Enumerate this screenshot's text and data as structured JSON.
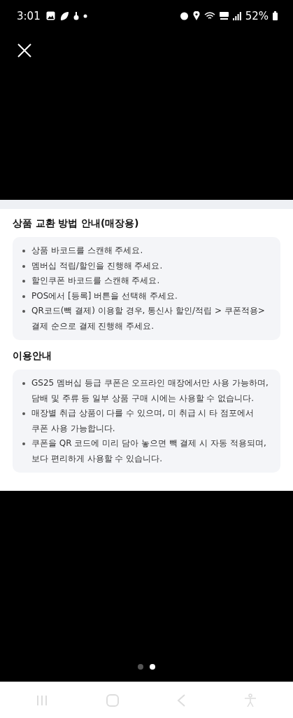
{
  "status_bar": {
    "time": "3:01",
    "battery": "52%"
  },
  "sections": [
    {
      "title": "상품 교환 방법 안내(매장용)",
      "items": [
        "상품 바코드를 스캔해 주세요.",
        "멤버십 적립/할인을 진행해 주세요.",
        "할인쿠폰 바코드를 스캔해 주세요.",
        "POS에서 [등록] 버튼을 선택해 주세요.",
        "QR코드(빽 결제) 이용할 경우, 통신사 할인/적립 > 쿠폰적용> 결제 순으로 결제 진행해 주세요."
      ]
    },
    {
      "title": "이용안내",
      "items": [
        "GS25 멤버십 등급 쿠폰은 오프라인 매장에서만 사용 가능하며, 담배 및 주류 등 일부 상품 구매 시에는 사용할 수 없습니다.",
        "매장별 취급 상품이 다를 수 있으며, 미 취급 시 타 점포에서 쿠폰 사용 가능합니다.",
        "쿠폰을 QR 코드에 미리 담아 놓으면 빽 결제 시 자동 적용되며, 보다 편리하게 사용할 수 있습니다."
      ]
    }
  ],
  "pager": [
    {
      "selected": false
    },
    {
      "selected": true
    }
  ]
}
